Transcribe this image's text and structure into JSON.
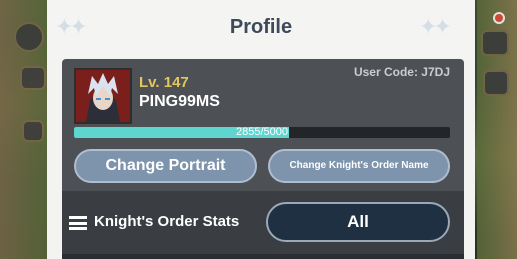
{
  "modal": {
    "title": "Profile"
  },
  "profile": {
    "user_code": "User Code: J7DJ",
    "level": "Lv. 147",
    "username": "PING99MS",
    "exp": {
      "current": 2855,
      "max": 5000,
      "label": "2855/5000",
      "fill_fraction": 0.571
    }
  },
  "buttons": {
    "change_portrait": "Change Portrait",
    "change_order_name": "Change Knight's Order Name"
  },
  "stats": {
    "label": "Knight's Order Stats",
    "filter_value": "All"
  },
  "colors": {
    "level": "#e5c55e",
    "exp_fill": "#5fd5d0",
    "button": "#7e93ac",
    "title": "#3e4a5a"
  }
}
